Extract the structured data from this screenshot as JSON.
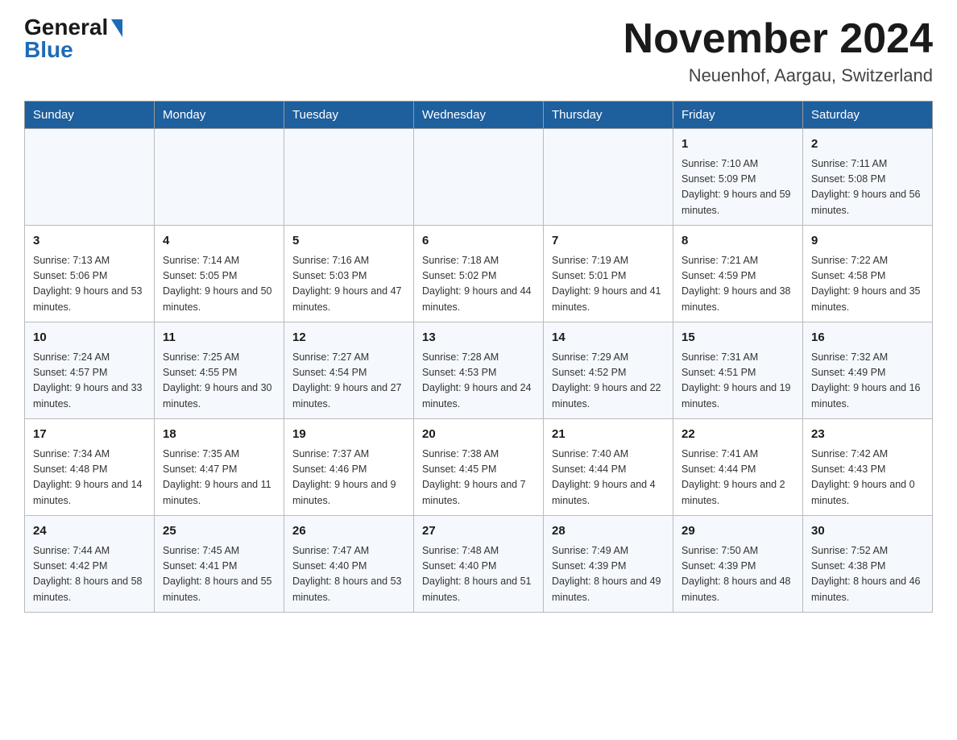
{
  "header": {
    "logo_general": "General",
    "logo_blue": "Blue",
    "month_title": "November 2024",
    "location": "Neuenhof, Aargau, Switzerland"
  },
  "days_of_week": [
    "Sunday",
    "Monday",
    "Tuesday",
    "Wednesday",
    "Thursday",
    "Friday",
    "Saturday"
  ],
  "weeks": [
    {
      "days": [
        {
          "number": "",
          "info": ""
        },
        {
          "number": "",
          "info": ""
        },
        {
          "number": "",
          "info": ""
        },
        {
          "number": "",
          "info": ""
        },
        {
          "number": "",
          "info": ""
        },
        {
          "number": "1",
          "info": "Sunrise: 7:10 AM\nSunset: 5:09 PM\nDaylight: 9 hours and 59 minutes."
        },
        {
          "number": "2",
          "info": "Sunrise: 7:11 AM\nSunset: 5:08 PM\nDaylight: 9 hours and 56 minutes."
        }
      ]
    },
    {
      "days": [
        {
          "number": "3",
          "info": "Sunrise: 7:13 AM\nSunset: 5:06 PM\nDaylight: 9 hours and 53 minutes."
        },
        {
          "number": "4",
          "info": "Sunrise: 7:14 AM\nSunset: 5:05 PM\nDaylight: 9 hours and 50 minutes."
        },
        {
          "number": "5",
          "info": "Sunrise: 7:16 AM\nSunset: 5:03 PM\nDaylight: 9 hours and 47 minutes."
        },
        {
          "number": "6",
          "info": "Sunrise: 7:18 AM\nSunset: 5:02 PM\nDaylight: 9 hours and 44 minutes."
        },
        {
          "number": "7",
          "info": "Sunrise: 7:19 AM\nSunset: 5:01 PM\nDaylight: 9 hours and 41 minutes."
        },
        {
          "number": "8",
          "info": "Sunrise: 7:21 AM\nSunset: 4:59 PM\nDaylight: 9 hours and 38 minutes."
        },
        {
          "number": "9",
          "info": "Sunrise: 7:22 AM\nSunset: 4:58 PM\nDaylight: 9 hours and 35 minutes."
        }
      ]
    },
    {
      "days": [
        {
          "number": "10",
          "info": "Sunrise: 7:24 AM\nSunset: 4:57 PM\nDaylight: 9 hours and 33 minutes."
        },
        {
          "number": "11",
          "info": "Sunrise: 7:25 AM\nSunset: 4:55 PM\nDaylight: 9 hours and 30 minutes."
        },
        {
          "number": "12",
          "info": "Sunrise: 7:27 AM\nSunset: 4:54 PM\nDaylight: 9 hours and 27 minutes."
        },
        {
          "number": "13",
          "info": "Sunrise: 7:28 AM\nSunset: 4:53 PM\nDaylight: 9 hours and 24 minutes."
        },
        {
          "number": "14",
          "info": "Sunrise: 7:29 AM\nSunset: 4:52 PM\nDaylight: 9 hours and 22 minutes."
        },
        {
          "number": "15",
          "info": "Sunrise: 7:31 AM\nSunset: 4:51 PM\nDaylight: 9 hours and 19 minutes."
        },
        {
          "number": "16",
          "info": "Sunrise: 7:32 AM\nSunset: 4:49 PM\nDaylight: 9 hours and 16 minutes."
        }
      ]
    },
    {
      "days": [
        {
          "number": "17",
          "info": "Sunrise: 7:34 AM\nSunset: 4:48 PM\nDaylight: 9 hours and 14 minutes."
        },
        {
          "number": "18",
          "info": "Sunrise: 7:35 AM\nSunset: 4:47 PM\nDaylight: 9 hours and 11 minutes."
        },
        {
          "number": "19",
          "info": "Sunrise: 7:37 AM\nSunset: 4:46 PM\nDaylight: 9 hours and 9 minutes."
        },
        {
          "number": "20",
          "info": "Sunrise: 7:38 AM\nSunset: 4:45 PM\nDaylight: 9 hours and 7 minutes."
        },
        {
          "number": "21",
          "info": "Sunrise: 7:40 AM\nSunset: 4:44 PM\nDaylight: 9 hours and 4 minutes."
        },
        {
          "number": "22",
          "info": "Sunrise: 7:41 AM\nSunset: 4:44 PM\nDaylight: 9 hours and 2 minutes."
        },
        {
          "number": "23",
          "info": "Sunrise: 7:42 AM\nSunset: 4:43 PM\nDaylight: 9 hours and 0 minutes."
        }
      ]
    },
    {
      "days": [
        {
          "number": "24",
          "info": "Sunrise: 7:44 AM\nSunset: 4:42 PM\nDaylight: 8 hours and 58 minutes."
        },
        {
          "number": "25",
          "info": "Sunrise: 7:45 AM\nSunset: 4:41 PM\nDaylight: 8 hours and 55 minutes."
        },
        {
          "number": "26",
          "info": "Sunrise: 7:47 AM\nSunset: 4:40 PM\nDaylight: 8 hours and 53 minutes."
        },
        {
          "number": "27",
          "info": "Sunrise: 7:48 AM\nSunset: 4:40 PM\nDaylight: 8 hours and 51 minutes."
        },
        {
          "number": "28",
          "info": "Sunrise: 7:49 AM\nSunset: 4:39 PM\nDaylight: 8 hours and 49 minutes."
        },
        {
          "number": "29",
          "info": "Sunrise: 7:50 AM\nSunset: 4:39 PM\nDaylight: 8 hours and 48 minutes."
        },
        {
          "number": "30",
          "info": "Sunrise: 7:52 AM\nSunset: 4:38 PM\nDaylight: 8 hours and 46 minutes."
        }
      ]
    }
  ]
}
